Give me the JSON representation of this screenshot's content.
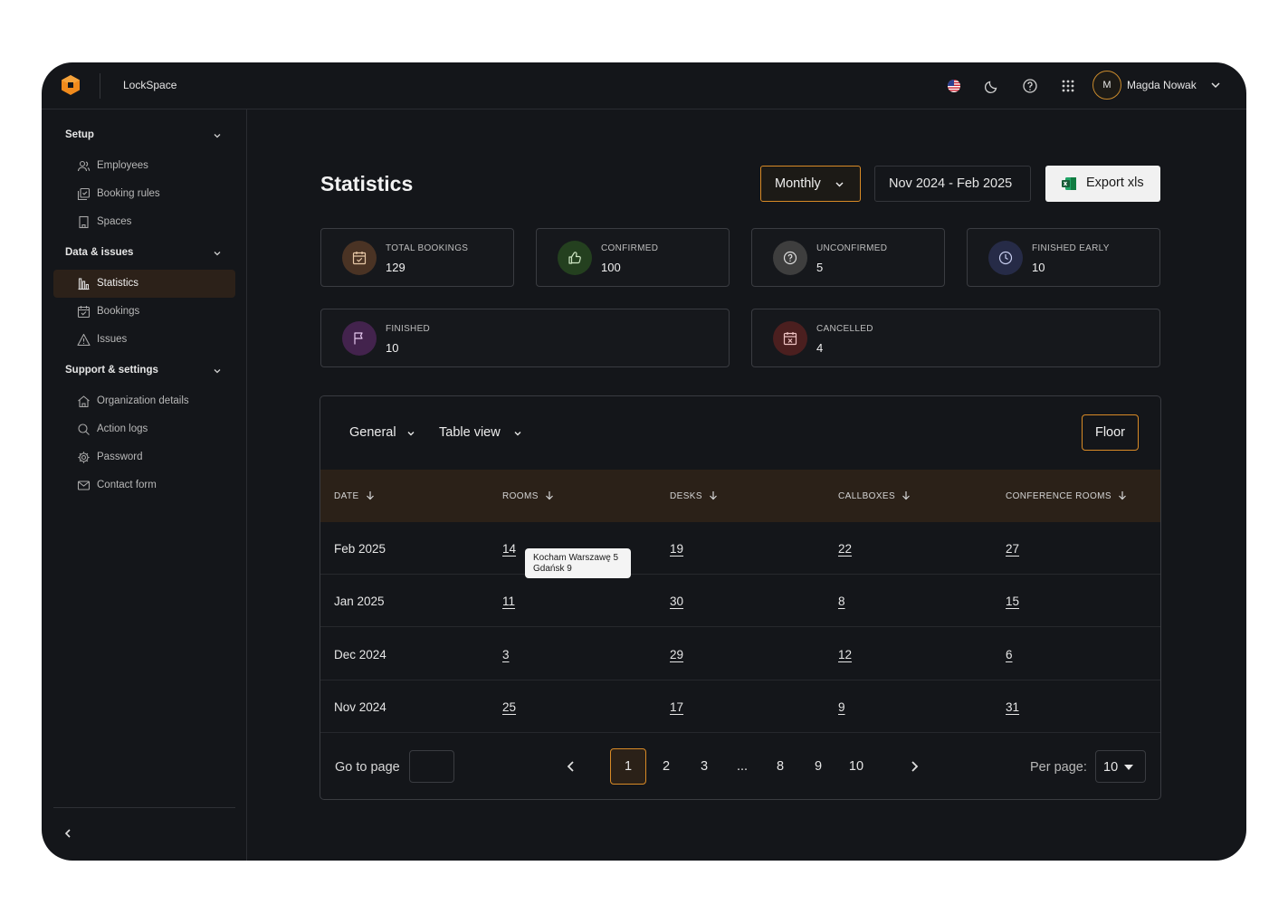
{
  "app": {
    "title": "LockSpace"
  },
  "user": {
    "initial": "M",
    "name": "Magda Nowak"
  },
  "sidebar": {
    "sections": [
      {
        "title": "Setup",
        "items": [
          {
            "label": "Employees",
            "icon": "users-icon"
          },
          {
            "label": "Booking rules",
            "icon": "rules-icon"
          },
          {
            "label": "Spaces",
            "icon": "building-icon"
          }
        ]
      },
      {
        "title": "Data & issues",
        "items": [
          {
            "label": "Statistics",
            "icon": "bar-chart-icon",
            "active": true
          },
          {
            "label": "Bookings",
            "icon": "calendar-check-icon"
          },
          {
            "label": "Issues",
            "icon": "warning-icon"
          }
        ]
      },
      {
        "title": "Support & settings",
        "items": [
          {
            "label": "Organization details",
            "icon": "home-icon"
          },
          {
            "label": "Action logs",
            "icon": "search-icon"
          },
          {
            "label": "Password",
            "icon": "gear-icon"
          },
          {
            "label": "Contact form",
            "icon": "mail-icon"
          }
        ]
      }
    ]
  },
  "main": {
    "title": "Statistics",
    "period": "Monthly",
    "range": "Nov 2024 - Feb 2025",
    "export": "Export xls"
  },
  "stats": [
    {
      "label": "TOTAL BOOKINGS",
      "value": "129",
      "color": "#4a3324",
      "icon": "calendar-check-icon"
    },
    {
      "label": "CONFIRMED",
      "value": "100",
      "color": "#24401f",
      "icon": "thumbs-up-icon"
    },
    {
      "label": "UNCONFIRMED",
      "value": "5",
      "color": "#3e3e3e",
      "icon": "question-icon"
    },
    {
      "label": "FINISHED EARLY",
      "value": "10",
      "color": "#262b47",
      "icon": "clock-icon"
    },
    {
      "label": "FINISHED",
      "value": "10",
      "color": "#43234d",
      "icon": "flag-icon"
    },
    {
      "label": "CANCELLED",
      "value": "4",
      "color": "#4b1f1f",
      "icon": "calendar-x-icon"
    }
  ],
  "table": {
    "view_type": "General",
    "view_mode": "Table view",
    "filter": "Floor",
    "headers": [
      "DATE",
      "ROOMS",
      "DESKS",
      "CALLBOXES",
      "CONFERENCE ROOMS"
    ],
    "rows": [
      [
        "Feb 2025",
        "14",
        "19",
        "22",
        "27"
      ],
      [
        "Jan 2025",
        "11",
        "30",
        "8",
        "15"
      ],
      [
        "Dec 2024",
        "3",
        "29",
        "12",
        "6"
      ],
      [
        "Nov 2024",
        "25",
        "17",
        "9",
        "31"
      ]
    ],
    "tooltip": [
      "Kocham Warszawę 5",
      "Gdańsk 9"
    ]
  },
  "pagination": {
    "goto_label": "Go to page",
    "pages": [
      "1",
      "2",
      "3",
      "...",
      "8",
      "9",
      "10"
    ],
    "current": "1",
    "per_page_label": "Per page:",
    "per_page": "10"
  }
}
